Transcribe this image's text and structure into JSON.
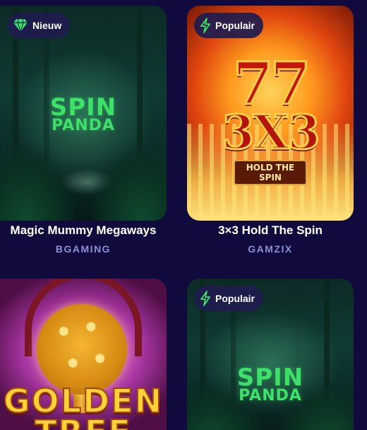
{
  "games": [
    {
      "badge": {
        "label": "Nieuw",
        "icon": "diamond-icon",
        "icon_color": "#3ee06a"
      },
      "art_title": [
        "SPIN",
        "PANDA"
      ],
      "title": "Magic Mummy Megaways",
      "provider": "BGAMING"
    },
    {
      "badge": {
        "label": "Populair",
        "icon": "lightning-icon",
        "icon_color": "#3ee06a"
      },
      "art_title": [
        "77",
        "3X3",
        "HOLD THE SPIN"
      ],
      "title": "3×3 Hold The Spin",
      "provider": "GAMZIX"
    },
    {
      "art_title": [
        "GOLDEN",
        "TREE"
      ]
    },
    {
      "badge": {
        "label": "Populair",
        "icon": "lightning-icon",
        "icon_color": "#3ee06a"
      },
      "art_title": [
        "SPIN",
        "PANDA"
      ]
    }
  ],
  "colors": {
    "background": "#110b3d",
    "provider_text": "#8e8fd4",
    "badge_bg": "#1e1c4e",
    "accent_green": "#3ee06a"
  }
}
